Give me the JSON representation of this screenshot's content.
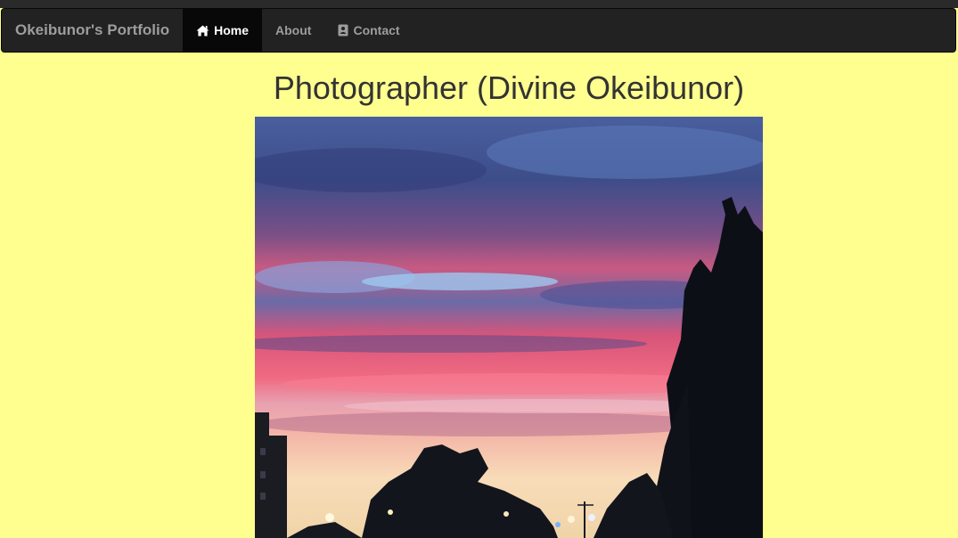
{
  "navbar": {
    "brand": "Okeibunor's Portfolio",
    "items": [
      {
        "label": "Home",
        "icon": "home-icon",
        "active": true
      },
      {
        "label": "About",
        "icon": "",
        "active": false
      },
      {
        "label": "Contact",
        "icon": "contact-card-icon",
        "active": false
      }
    ]
  },
  "main": {
    "title": "Photographer (Divine Okeibunor)"
  },
  "colors": {
    "page_bg": "#ffff90",
    "navbar_bg": "#222222",
    "active_bg": "#080808"
  }
}
